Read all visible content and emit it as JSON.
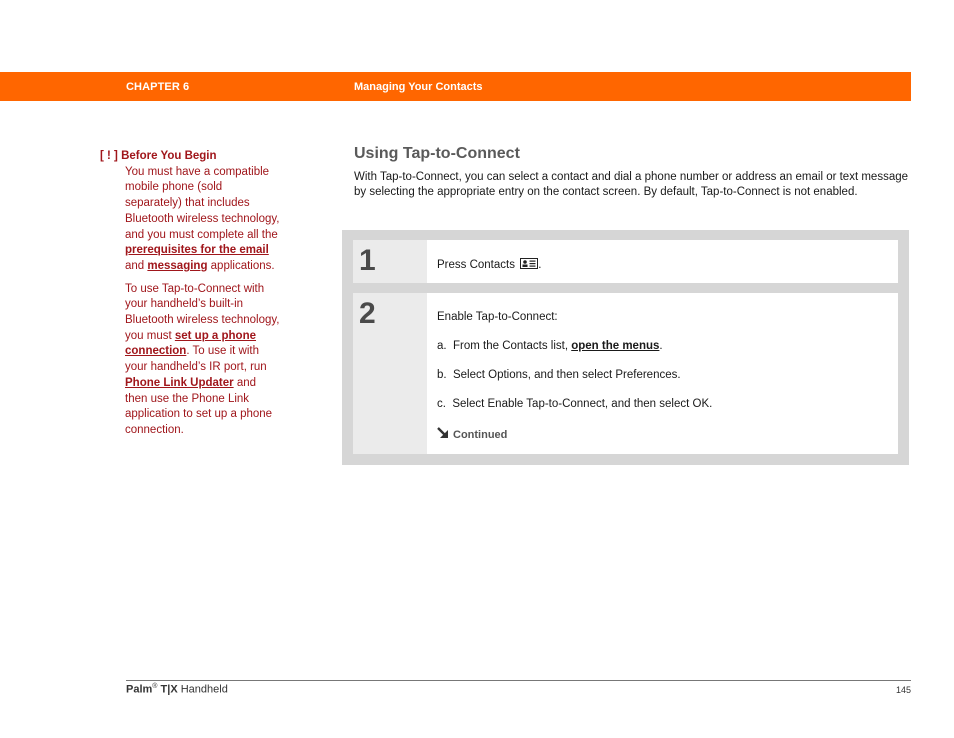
{
  "header": {
    "chapter": "CHAPTER 6",
    "title": "Managing Your Contacts",
    "bar_color": "#ff6600"
  },
  "sidebar": {
    "note_mark": "[ ! ]",
    "note_title": "Before You Begin",
    "para1": {
      "text_before": "You must have a compatible mobile phone (sold separately) that includes Bluetooth wireless technology, and you must complete all the ",
      "link1": "prerequisites for the email",
      "text_mid": " and ",
      "link2": "messaging",
      "text_after": " applications."
    },
    "para2": {
      "text_before": "To use Tap-to-Connect with your handheld’s built-in Bluetooth wireless technology, you must ",
      "link1": "set up a phone connection",
      "text_mid": ". To use it with your handheld’s IR port, run ",
      "link2": "Phone Link Updater",
      "text_after": " and then use the Phone Link application to set up a phone connection."
    },
    "text_color": "#a0161b"
  },
  "main": {
    "title": "Using Tap-to-Connect",
    "intro": "With Tap-to-Connect, you can select a contact and dial a phone number or address an email or text message by selecting the appropriate entry on the contact screen. By default, Tap-to-Connect is not enabled."
  },
  "steps": [
    {
      "number": "1",
      "text": "Press Contacts",
      "icon": "contacts-icon",
      "suffix": "."
    },
    {
      "number": "2",
      "text": "Enable Tap-to-Connect:",
      "substeps": [
        {
          "label": "a.",
          "text_before": "From the Contacts list, ",
          "link": "open the menus",
          "text_after": "."
        },
        {
          "label": "b.",
          "text": "Select Options, and then select Preferences."
        },
        {
          "label": "c.",
          "text": "Select Enable Tap-to-Connect, and then select OK."
        }
      ],
      "continued": "Continued"
    }
  ],
  "footer": {
    "brand": "Palm",
    "reg": "®",
    "model": "T|X",
    "product": "Handheld",
    "page": "145"
  }
}
